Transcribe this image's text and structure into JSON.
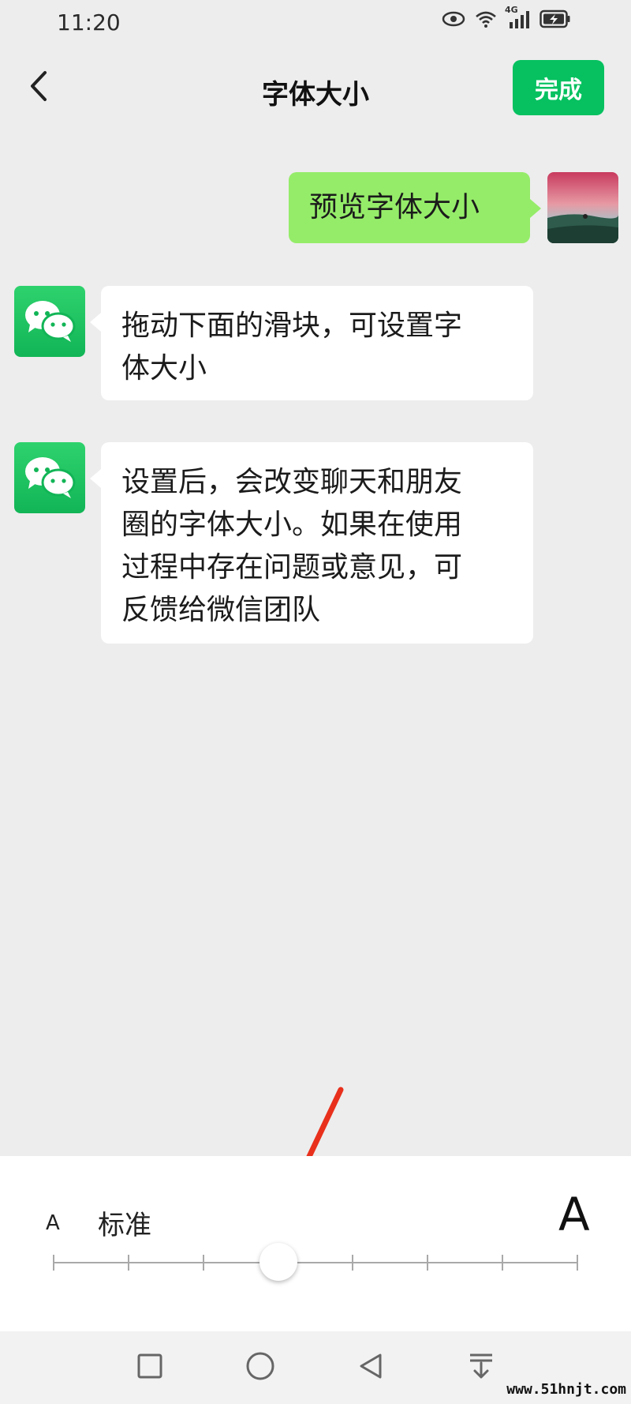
{
  "status_bar": {
    "time": "11:20",
    "network_label": "4G",
    "icons": [
      "eye-icon",
      "wifi-icon",
      "signal-icon",
      "battery-charging-icon"
    ]
  },
  "header": {
    "title": "字体大小",
    "done_label": "完成",
    "back_icon": "chevron-left-icon"
  },
  "messages": [
    {
      "direction": "outgoing",
      "sender": "user",
      "text": "预览字体大小"
    },
    {
      "direction": "incoming",
      "sender": "wechat",
      "lines": [
        "拖动下面的滑块，可设置字",
        "体大小"
      ]
    },
    {
      "direction": "incoming",
      "sender": "wechat",
      "lines": [
        "设置后，会改变聊天和朋友",
        "圈的字体大小。如果在使用",
        "过程中存在问题或意见，可",
        "反馈给微信团队"
      ]
    }
  ],
  "font_panel": {
    "small_label": "A",
    "current_size_label": "标准",
    "large_label": "A",
    "slider": {
      "steps": 8,
      "selected_index": 3
    }
  },
  "system_nav": {
    "buttons": [
      "recent-apps-icon",
      "home-icon",
      "back-triangle-icon",
      "notification-pull-icon"
    ]
  },
  "watermark": "www.51hnjt.com",
  "colors": {
    "accent": "#07c160",
    "outgoing_bubble": "#95ec69",
    "background": "#ededed",
    "arrow": "#e8301c"
  }
}
